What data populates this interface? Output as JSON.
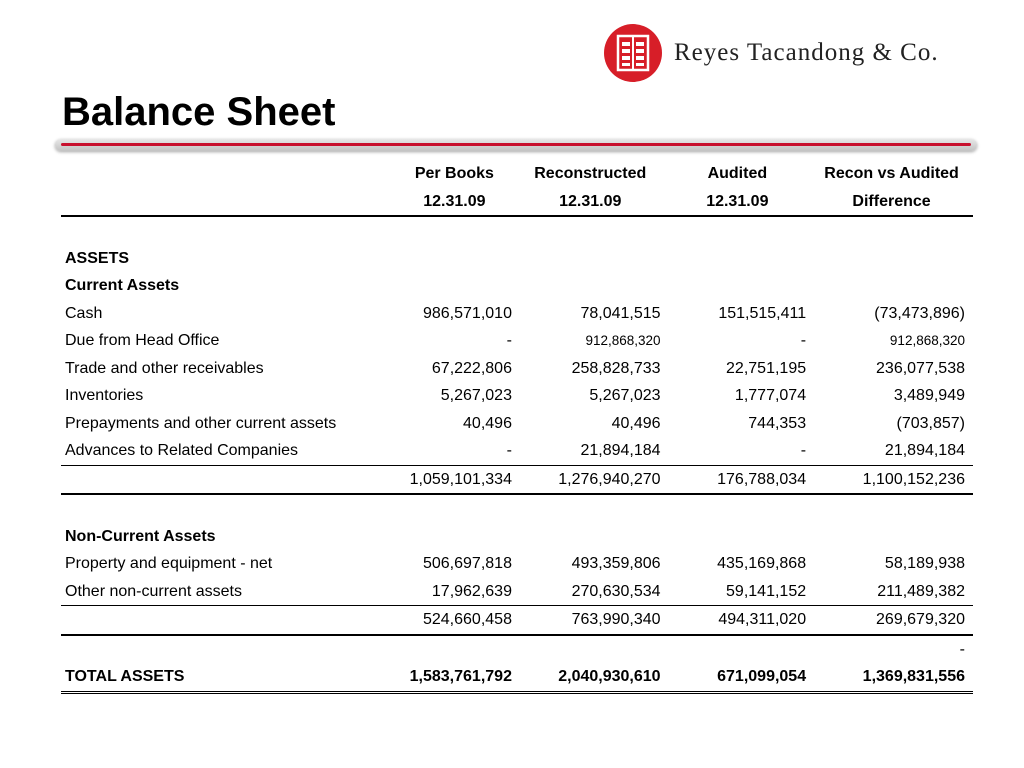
{
  "logo": {
    "company": "Reyes Tacandong & Co."
  },
  "title": "Balance Sheet",
  "columns": [
    {
      "line1": "Per Books",
      "line2": "12.31.09"
    },
    {
      "line1": "Reconstructed",
      "line2": "12.31.09"
    },
    {
      "line1": "Audited",
      "line2": "12.31.09"
    },
    {
      "line1": "Recon vs Audited",
      "line2": "Difference"
    }
  ],
  "sections": {
    "assets": "ASSETS",
    "current": "Current Assets",
    "noncurrent": "Non-Current Assets"
  },
  "current_rows": [
    {
      "label": "Cash",
      "values": [
        "986,571,010",
        "78,041,515",
        "151,515,411",
        "(73,473,896)"
      ]
    },
    {
      "label": "Due from Head Office",
      "values": [
        "-",
        "912,868,320",
        "-",
        "912,868,320"
      ]
    },
    {
      "label": "Trade and other receivables",
      "values": [
        "67,222,806",
        "258,828,733",
        "22,751,195",
        "236,077,538"
      ]
    },
    {
      "label": "Inventories",
      "values": [
        "5,267,023",
        "5,267,023",
        "1,777,074",
        "3,489,949"
      ]
    },
    {
      "label": "Prepayments and other current assets",
      "values": [
        "40,496",
        "40,496",
        "744,353",
        "(703,857)"
      ]
    },
    {
      "label": "Advances to Related Companies",
      "values": [
        "-",
        "21,894,184",
        "-",
        "21,894,184"
      ]
    }
  ],
  "current_total": [
    "1,059,101,334",
    "1,276,940,270",
    "176,788,034",
    "1,100,152,236"
  ],
  "noncurrent_rows": [
    {
      "label": "Property and equipment - net",
      "values": [
        "506,697,818",
        "493,359,806",
        "435,169,868",
        "58,189,938"
      ]
    },
    {
      "label": "Other non-current assets",
      "values": [
        "17,962,639",
        "270,630,534",
        "59,141,152",
        "211,489,382"
      ]
    }
  ],
  "noncurrent_total": [
    "524,660,458",
    "763,990,340",
    "494,311,020",
    "269,679,320"
  ],
  "dash_row": "-",
  "total_assets": {
    "label": "TOTAL ASSETS",
    "values": [
      "1,583,761,792",
      "2,040,930,610",
      "671,099,054",
      "1,369,831,556"
    ]
  }
}
